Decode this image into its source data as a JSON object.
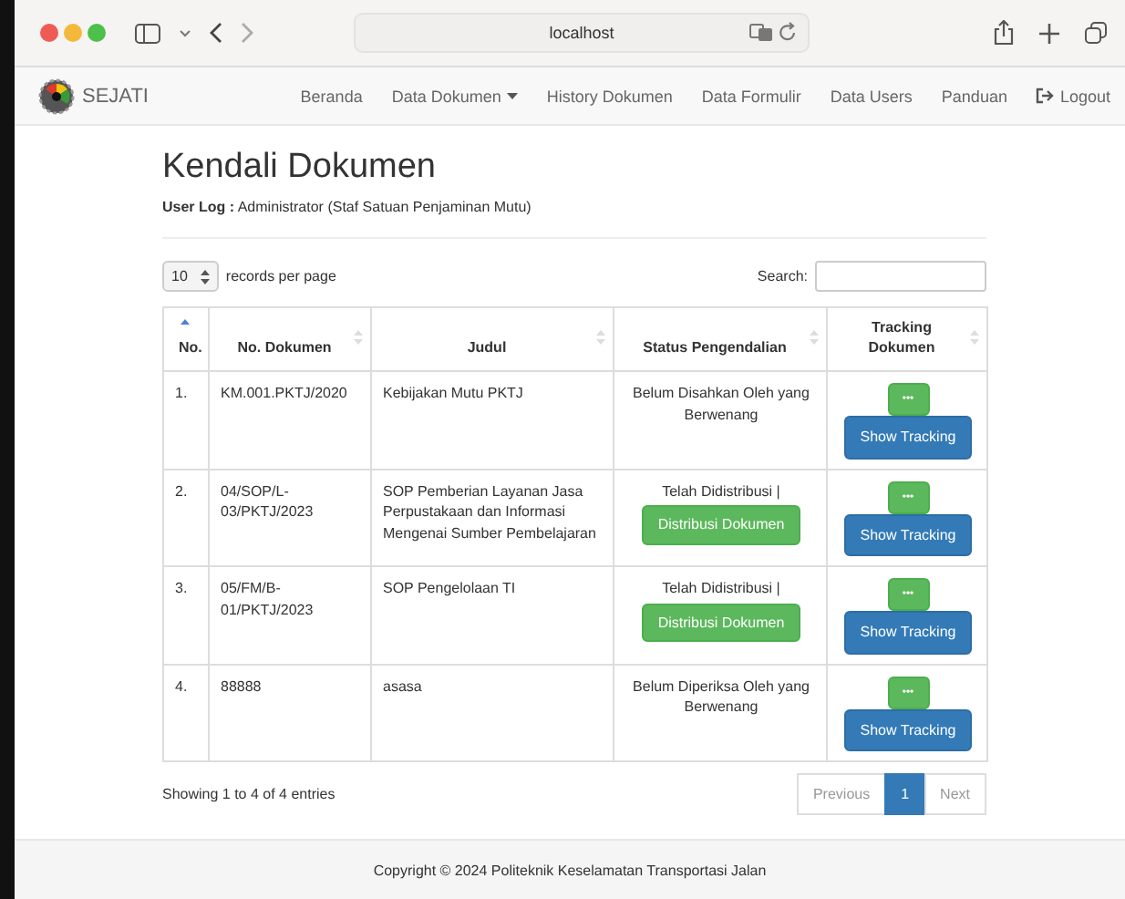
{
  "browser": {
    "address": "localhost"
  },
  "navbar": {
    "brand": "SEJATI",
    "items": [
      {
        "label": "Beranda",
        "dropdown": false,
        "kind": "link"
      },
      {
        "label": "Data Dokumen",
        "dropdown": true,
        "kind": "link"
      },
      {
        "label": "History Dokumen",
        "dropdown": false,
        "kind": "link"
      },
      {
        "label": "Data Formulir",
        "dropdown": false,
        "kind": "link"
      },
      {
        "label": "Data Users",
        "dropdown": false,
        "kind": "link"
      },
      {
        "label": "Panduan",
        "dropdown": false,
        "kind": "link"
      },
      {
        "label": "Logout",
        "dropdown": false,
        "kind": "logout"
      }
    ]
  },
  "page": {
    "title": "Kendali Dokumen",
    "user_log": "**User Log :** Administrator (Staf Satuan Penjaminan Mutu)"
  },
  "table_controls": {
    "page_size": "10",
    "page_size_label": "records per page",
    "search_label": "Search:"
  },
  "table": {
    "columns": [
      {
        "label": "No.",
        "sorted": true
      },
      {
        "label": "No. Dokumen",
        "sorted": false
      },
      {
        "label": "Judul",
        "sorted": false
      },
      {
        "label": "Status Pengendalian",
        "sorted": false
      },
      {
        "label": "Tracking Dokumen",
        "sorted": false
      }
    ],
    "rows": [
      {
        "no": "1.",
        "doc_no": "KM.001.PKTJ/2020",
        "title": "Kebijakan Mutu PKTJ",
        "status": "Belum Disahkan Oleh yang Berwenang",
        "status_button": null,
        "more_button": "•••",
        "tracking_button": "Show Tracking"
      },
      {
        "no": "2.",
        "doc_no": "04/SOP/L-03/PKTJ/2023",
        "title": "SOP Pemberian Layanan Jasa Perpustakaan dan Informasi Mengenai Sumber Pembelajaran",
        "status": "Telah Didistribusi |",
        "status_button": "Distribusi Dokumen",
        "more_button": "•••",
        "tracking_button": "Show Tracking"
      },
      {
        "no": "3.",
        "doc_no": "05/FM/B-01/PKTJ/2023",
        "title": "SOP Pengelolaan TI",
        "status": "Telah Didistribusi |",
        "status_button": "Distribusi Dokumen",
        "more_button": "•••",
        "tracking_button": "Show Tracking"
      },
      {
        "no": "4.",
        "doc_no": "88888",
        "title": "asasa",
        "status": "Belum Diperiksa Oleh yang Berwenang",
        "status_button": null,
        "more_button": "•••",
        "tracking_button": "Show Tracking"
      }
    ]
  },
  "pagination": {
    "info": "Showing 1 to 4 of 4 entries",
    "previous": {
      "label": "Previous",
      "disabled": true
    },
    "pages": [
      {
        "label": "1",
        "selected": true
      }
    ],
    "next": {
      "label": "Next",
      "disabled": true
    }
  },
  "footer": "Copyright © 2024 Politeknik Keselamatan Transportasi Jalan"
}
